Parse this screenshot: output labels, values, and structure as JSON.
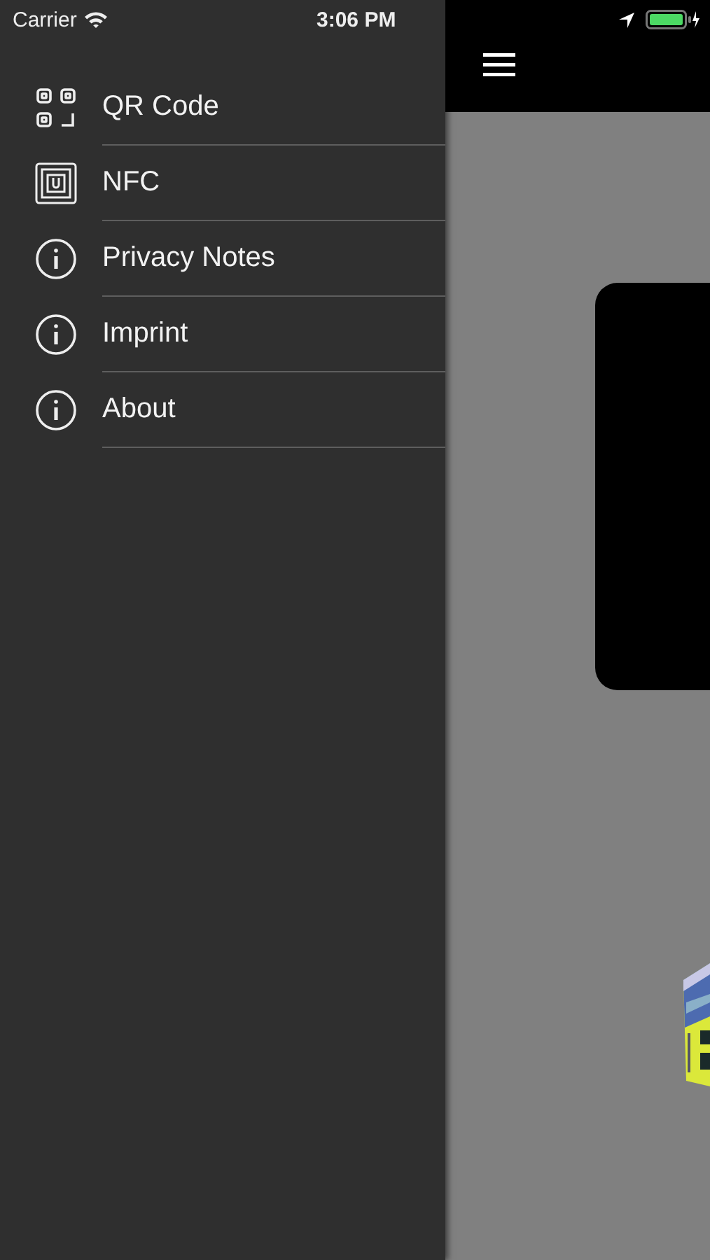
{
  "status_bar": {
    "carrier": "Carrier",
    "time": "3:06 PM"
  },
  "menu": {
    "items": [
      {
        "label": "QR Code",
        "kind": "qr"
      },
      {
        "label": "NFC",
        "kind": "nfc"
      },
      {
        "label": "Privacy Notes",
        "kind": "info"
      },
      {
        "label": "Imprint",
        "kind": "info"
      },
      {
        "label": "About",
        "kind": "info"
      }
    ]
  }
}
